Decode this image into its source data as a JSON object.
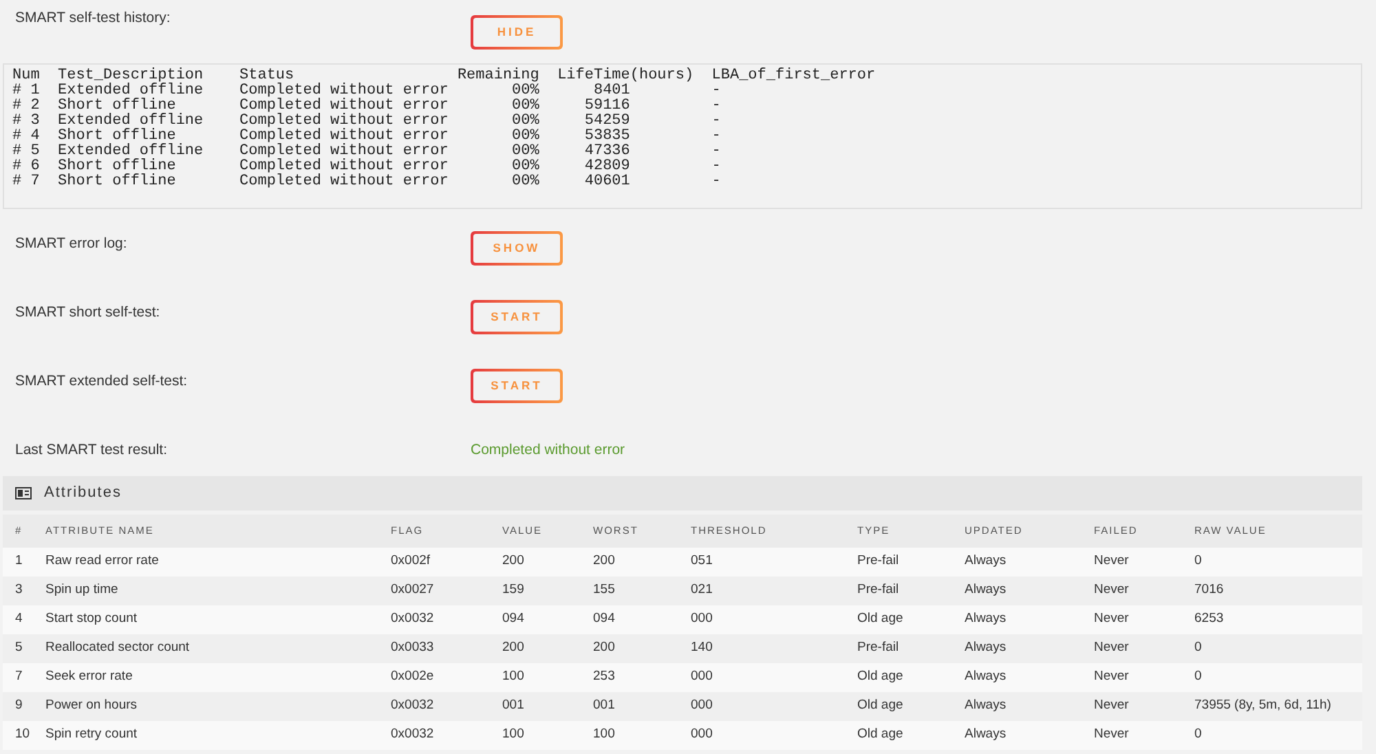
{
  "self_test_history": {
    "label": "SMART self-test history:",
    "button": "HIDE",
    "log_lines": [
      "Num  Test_Description    Status                  Remaining  LifeTime(hours)  LBA_of_first_error",
      "# 1  Extended offline    Completed without error       00%      8401         -",
      "# 2  Short offline       Completed without error       00%     59116         -",
      "# 3  Extended offline    Completed without error       00%     54259         -",
      "# 4  Short offline       Completed without error       00%     53835         -",
      "# 5  Extended offline    Completed without error       00%     47336         -",
      "# 6  Short offline       Completed without error       00%     42809         -",
      "# 7  Short offline       Completed without error       00%     40601         -"
    ]
  },
  "actions": [
    {
      "label": "SMART error log:",
      "button": "SHOW"
    },
    {
      "label": "SMART short self-test:",
      "button": "START"
    },
    {
      "label": "SMART extended self-test:",
      "button": "START"
    }
  ],
  "last_result": {
    "label": "Last SMART test result:",
    "value": "Completed without error"
  },
  "attributes": {
    "title": "Attributes",
    "table": {
      "columns": [
        "#",
        "ATTRIBUTE NAME",
        "FLAG",
        "VALUE",
        "WORST",
        "THRESHOLD",
        "TYPE",
        "UPDATED",
        "FAILED",
        "RAW VALUE"
      ],
      "rows": [
        [
          "1",
          "Raw read error rate",
          "0x002f",
          "200",
          "200",
          "051",
          "Pre-fail",
          "Always",
          "Never",
          "0"
        ],
        [
          "3",
          "Spin up time",
          "0x0027",
          "159",
          "155",
          "021",
          "Pre-fail",
          "Always",
          "Never",
          "7016"
        ],
        [
          "4",
          "Start stop count",
          "0x0032",
          "094",
          "094",
          "000",
          "Old age",
          "Always",
          "Never",
          "6253"
        ],
        [
          "5",
          "Reallocated sector count",
          "0x0033",
          "200",
          "200",
          "140",
          "Pre-fail",
          "Always",
          "Never",
          "0"
        ],
        [
          "7",
          "Seek error rate",
          "0x002e",
          "100",
          "253",
          "000",
          "Old age",
          "Always",
          "Never",
          "0"
        ],
        [
          "9",
          "Power on hours",
          "0x0032",
          "001",
          "001",
          "000",
          "Old age",
          "Always",
          "Never",
          "73955 (8y, 5m, 6d, 11h)"
        ],
        [
          "10",
          "Spin retry count",
          "0x0032",
          "100",
          "100",
          "000",
          "Old age",
          "Always",
          "Never",
          "0"
        ]
      ]
    }
  }
}
